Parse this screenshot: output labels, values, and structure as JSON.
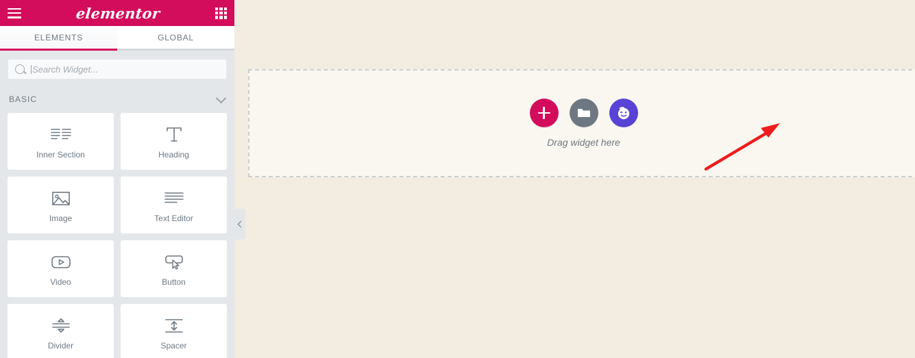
{
  "panel": {
    "header": {
      "menu_icon": "hamburger-icon",
      "logo_text": "elementor",
      "apps_icon": "grid-apps-icon"
    },
    "tabs": [
      {
        "label": "ELEMENTS",
        "active": true
      },
      {
        "label": "GLOBAL",
        "active": false
      }
    ],
    "search": {
      "placeholder": "Search Widget...",
      "value": "",
      "icon": "search-icon"
    },
    "category": {
      "title": "BASIC",
      "expanded": true,
      "chevron": "chevron-down-icon"
    },
    "widgets": [
      {
        "label": "Inner Section",
        "icon": "inner-section-icon"
      },
      {
        "label": "Heading",
        "icon": "heading-icon"
      },
      {
        "label": "Image",
        "icon": "image-icon"
      },
      {
        "label": "Text Editor",
        "icon": "text-editor-icon"
      },
      {
        "label": "Video",
        "icon": "video-icon"
      },
      {
        "label": "Button",
        "icon": "button-icon"
      },
      {
        "label": "Divider",
        "icon": "divider-icon"
      },
      {
        "label": "Spacer",
        "icon": "spacer-icon"
      }
    ],
    "collapse": {
      "icon": "chevron-left-icon"
    }
  },
  "canvas": {
    "drop_zone": {
      "hint": "Drag widget here",
      "buttons": [
        {
          "name": "add-new-section",
          "icon": "plus-icon",
          "color": "#d30c5c"
        },
        {
          "name": "add-template-folder",
          "icon": "folder-icon",
          "color": "#6d7882"
        },
        {
          "name": "elementor-ai",
          "icon": "winking-face-icon",
          "color": "#5843d6"
        }
      ]
    },
    "annotation": {
      "type": "red-arrow",
      "color": "#ee1c1c",
      "points_to": "add-new-section"
    }
  },
  "colors": {
    "brand_pink": "#d30c5c",
    "panel_bg": "#e4e7ea",
    "canvas_bg": "#f3ece0",
    "drop_bg": "#faf7f0",
    "text_gray": "#6d7882",
    "ai_purple": "#5843d6",
    "annotation_red": "#ee1c1c"
  }
}
